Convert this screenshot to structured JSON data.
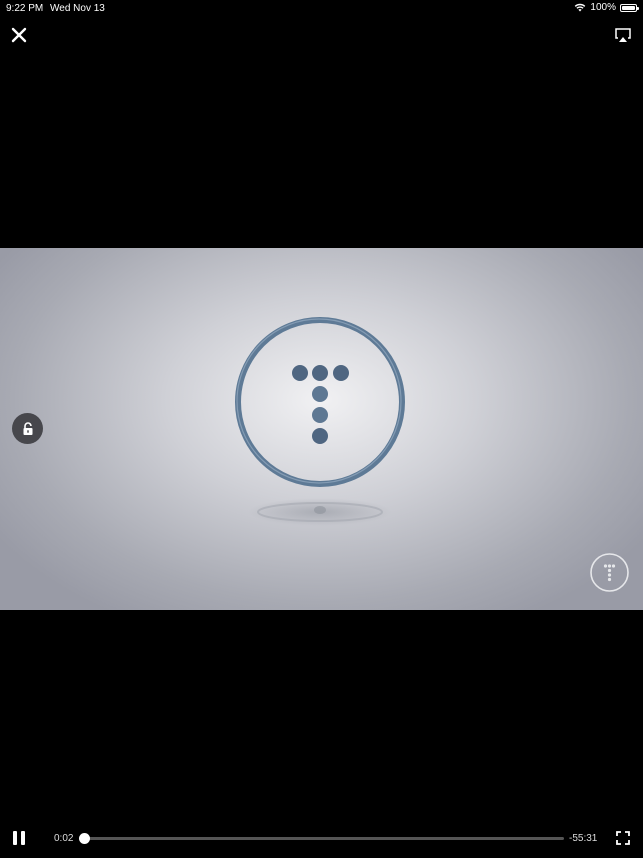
{
  "status_bar": {
    "time": "9:22 PM",
    "date": "Wed Nov 13",
    "battery_text": "100%",
    "icons": [
      "wifi-icon",
      "battery-icon"
    ]
  },
  "top_bar": {
    "icons": [
      "close-icon",
      "airplay-icon"
    ]
  },
  "video": {
    "logo_icon": "t-dots-logo",
    "watermark_icon": "t-dots-watermark",
    "logo_color": "#5a7592"
  },
  "side_controls": {
    "icons": [
      "lock-open-icon"
    ]
  },
  "playback": {
    "elapsed": "0:02",
    "remaining": "-55:31",
    "progress_fraction": 0.0006,
    "icons": [
      "pause-icon",
      "fullscreen-icon"
    ]
  },
  "colors": {
    "background": "#000000",
    "foreground": "#ffffff"
  }
}
